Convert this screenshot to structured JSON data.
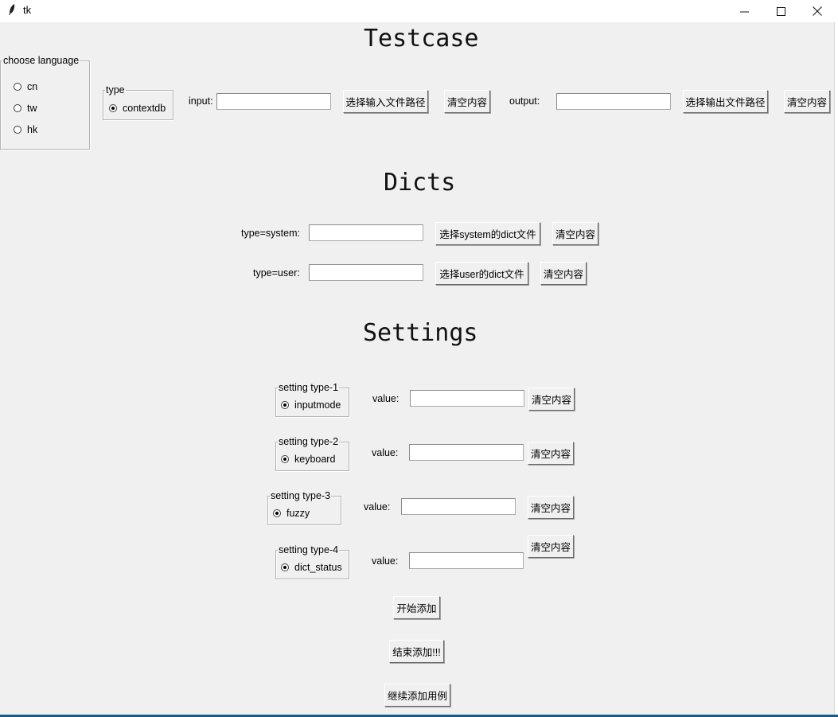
{
  "window": {
    "title": "tk",
    "icon": "feather-icon",
    "minimize": "—",
    "maximize": "☐",
    "close": "✕"
  },
  "testcase": {
    "heading": "Testcase",
    "language": {
      "legend": "choose language",
      "options": [
        "cn",
        "tw",
        "hk"
      ]
    },
    "type": {
      "legend": "type",
      "option": "contextdb",
      "selected": true
    },
    "input_label": "input:",
    "input_value": "",
    "select_input_button": "选择输入文件路径",
    "clear_input_button": "清空内容",
    "output_label": "output:",
    "output_value": "",
    "select_output_button": "选择输出文件路径",
    "clear_output_button": "清空内容"
  },
  "dicts": {
    "heading": "Dicts",
    "system": {
      "label": "type=system:",
      "value": "",
      "select_button": "选择system的dict文件",
      "clear_button": "清空内容"
    },
    "user": {
      "label": "type=user:",
      "value": "",
      "select_button": "选择user的dict文件",
      "clear_button": "清空内容"
    }
  },
  "settings": {
    "heading": "Settings",
    "items": [
      {
        "legend": "setting type-1",
        "option": "inputmode",
        "value_label": "value:",
        "value": "",
        "clear_button": "清空内容"
      },
      {
        "legend": "setting type-2",
        "option": "keyboard",
        "value_label": "value:",
        "value": "",
        "clear_button": "清空内容"
      },
      {
        "legend": "setting type-3",
        "option": "fuzzy",
        "value_label": "value:",
        "value": "",
        "clear_button": "清空内容"
      },
      {
        "legend": "setting type-4",
        "option": "dict_status",
        "value_label": "value:",
        "value": "",
        "clear_button": "清空内容"
      }
    ]
  },
  "actions": {
    "start": "开始添加",
    "finish": "结束添加!!!",
    "continue": "继续添加用例"
  }
}
